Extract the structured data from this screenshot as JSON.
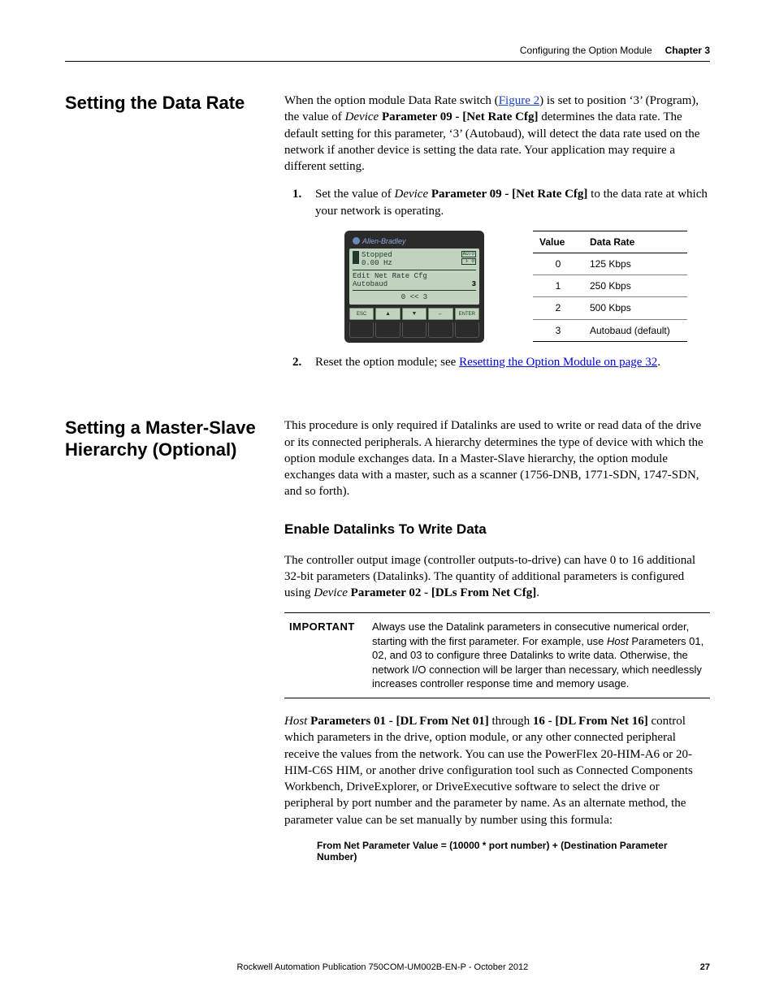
{
  "header": {
    "section": "Configuring the Option Module",
    "chapter": "Chapter 3"
  },
  "section1": {
    "title": "Setting the Data Rate",
    "intro_pre": "When the option module Data Rate switch (",
    "intro_link": "Figure 2",
    "intro_post1": ") is set to position ‘3’ (Program), the value of ",
    "intro_device": "Device",
    "intro_param": " Parameter 09 - [Net Rate Cfg]",
    "intro_post2": " determines the data rate. The default setting for this parameter, ‘3’ (Autobaud), will detect the data rate used on the network if another device is setting the data rate. Your application may require a different setting.",
    "step1_pre": "Set the value of ",
    "step1_device": "Device",
    "step1_param": " Parameter 09 - [Net Rate Cfg]",
    "step1_post": " to the data rate at which your network is operating.",
    "step2_pre": "Reset the option module; see ",
    "step2_link": "Resetting the Option Module on page 32",
    "step2_post": "."
  },
  "him": {
    "brand": "Allen-Bradley",
    "status": "Stopped",
    "hz": "0.00 Hz",
    "badge1": "AUTO",
    "badge2": "F   0",
    "edit_label": "Edit Net Rate Cfg",
    "value_label": "Autobaud",
    "value_num": "3",
    "range": "0  <<  3",
    "keys": {
      "esc": "ESC",
      "up": "▲",
      "down": "▼",
      "left": "←",
      "enter": "ENTER"
    }
  },
  "rate_table": {
    "headers": [
      "Value",
      "Data Rate"
    ],
    "rows": [
      [
        "0",
        "125 Kbps"
      ],
      [
        "1",
        "250 Kbps"
      ],
      [
        "2",
        "500 Kbps"
      ],
      [
        "3",
        "Autobaud (default)"
      ]
    ]
  },
  "section2": {
    "title": "Setting a Master-Slave Hierarchy (Optional)",
    "intro": "This procedure is only required if Datalinks are used to write or read data of the drive or its connected peripherals. A hierarchy determines the type of device with which the option module exchanges data. In a Master-Slave hierarchy, the option module exchanges data with a master, such as a scanner (1756-DNB, 1771-SDN, 1747-SDN, and so forth).",
    "subhead": "Enable Datalinks To Write Data",
    "para2_pre": "The controller output image (controller outputs-to-drive) can have 0 to 16 additional 32-bit parameters (Datalinks). The quantity of additional parameters is configured using ",
    "para2_device": "Device",
    "para2_param": " Parameter 02 - [DLs From Net Cfg]",
    "para2_post": ".",
    "important_label": "IMPORTANT",
    "important_pre": "Always use the Datalink parameters in consecutive numerical order, starting with the first parameter. For example, use ",
    "important_host": "Host",
    "important_post": " Parameters 01, 02, and 03 to configure three Datalinks to write data. Otherwise, the network I/O connection will be larger than necessary, which needlessly increases controller response time and memory usage.",
    "para3_host": "Host",
    "para3_bold1": " Parameters 01 - [DL From Net 01]",
    "para3_mid": " through ",
    "para3_bold2": "16 - [DL From Net 16]",
    "para3_rest": " control which parameters in the drive, option module, or any other connected peripheral receive the values from the network. You can use the PowerFlex 20-HIM-A6 or 20-HIM-C6S HIM, or another drive configuration tool such as Connected Components Workbench, DriveExplorer, or DriveExecutive software to select the drive or peripheral by port number and the parameter by name. As an alternate method, the parameter value can be set manually by number using this formula:",
    "formula": "From Net Parameter Value = (10000 * port number) + (Destination Parameter Number)"
  },
  "footer": {
    "pub": "Rockwell Automation Publication 750COM-UM002B-EN-P - October 2012",
    "page": "27"
  }
}
